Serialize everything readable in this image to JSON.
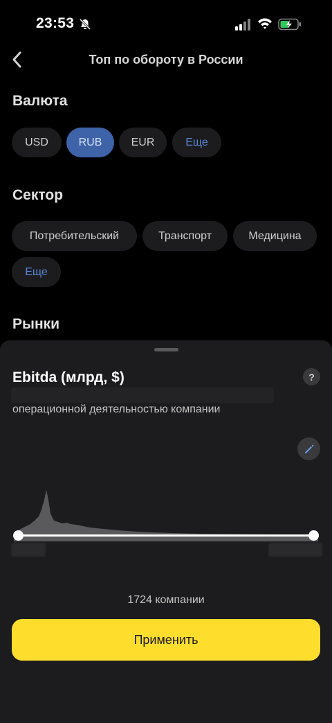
{
  "status_bar": {
    "time": "23:53"
  },
  "nav": {
    "title": "Топ по обороту в России"
  },
  "currency": {
    "title": "Валюта",
    "options": [
      "USD",
      "RUB",
      "EUR"
    ],
    "selected": "RUB",
    "more": "Еще"
  },
  "sector": {
    "title": "Сектор",
    "options": [
      "Потребительский",
      "Транспорт",
      "Медицина"
    ],
    "more": "Еще"
  },
  "markets": {
    "title": "Рынки"
  },
  "sheet": {
    "title": "Ebitda (млрд, $)",
    "help": "?",
    "description": "операционной деятельностью компании",
    "count_text": "1724 компании",
    "apply_label": "Применить"
  },
  "colors": {
    "accent_yellow": "#ffdd2d",
    "selected_chip": "#3e63a8",
    "link_blue": "#5a86d6"
  }
}
